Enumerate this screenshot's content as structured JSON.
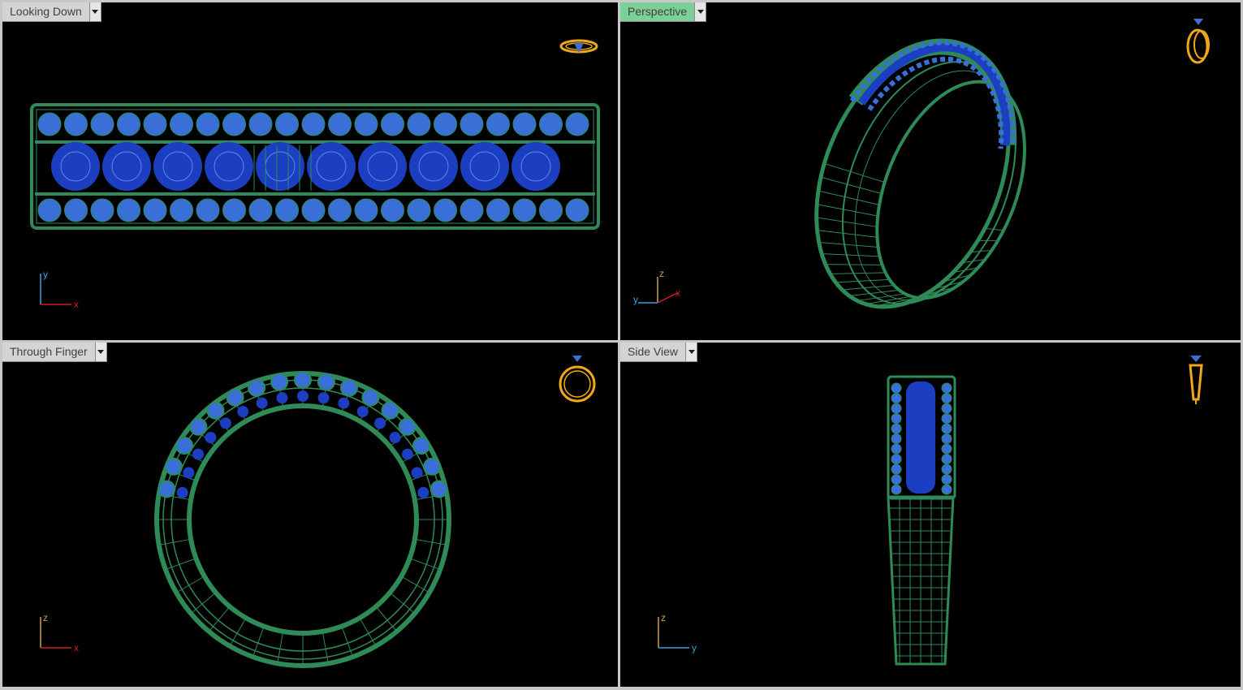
{
  "viewports": {
    "top_left": {
      "title": "Looking Down",
      "active": false,
      "axes": {
        "vertical": "y",
        "horizontal": "x"
      }
    },
    "top_right": {
      "title": "Perspective",
      "active": true,
      "axes": {
        "vertical": "z",
        "horizontal": "x",
        "depth": "y"
      }
    },
    "bottom_left": {
      "title": "Through Finger",
      "active": false,
      "axes": {
        "vertical": "z",
        "horizontal": "x"
      }
    },
    "bottom_right": {
      "title": "Side View",
      "active": false,
      "axes": {
        "vertical": "z",
        "horizontal": "y"
      }
    }
  },
  "icons": {
    "dropdown": "chevron-down-icon",
    "view_cube": "ring-orientation-icon",
    "axis": "axis-gizmo-icon"
  },
  "colors": {
    "background": "#000000",
    "frame": "#c8c8c8",
    "wire_green": "#2e8b57",
    "gem_blue": "#3a6fd8",
    "gem_dark_blue": "#1b3fc0",
    "orient_icon": "#f0a818",
    "axis_x": "#d02020",
    "axis_y": "#3aa0d8",
    "axis_z": "#c8a050",
    "active_tab": "#7ccf99"
  }
}
